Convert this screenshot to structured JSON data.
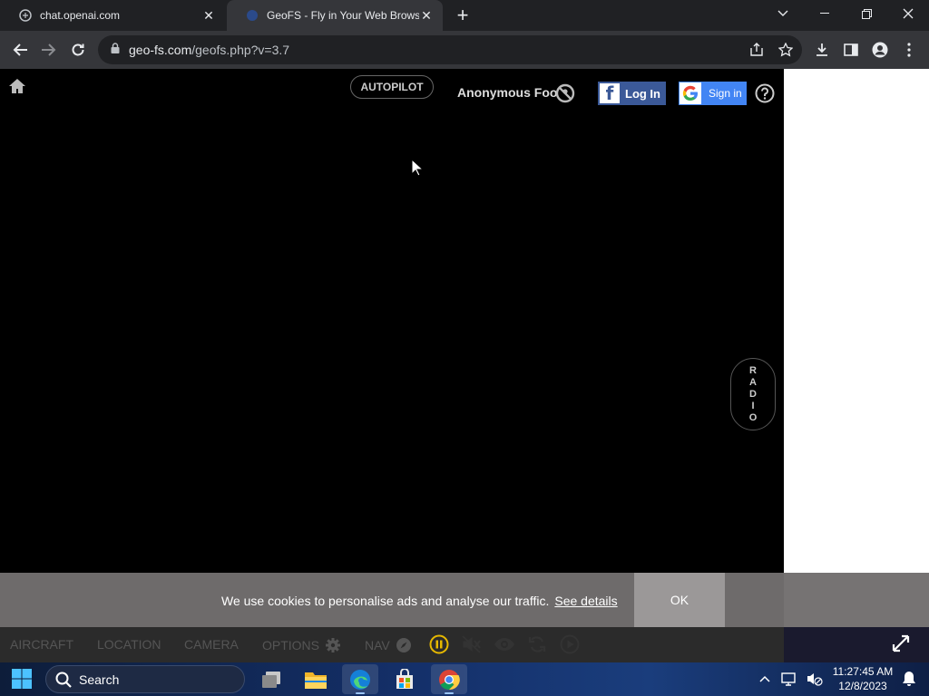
{
  "browser": {
    "tabs": [
      {
        "title": "chat.openai.com",
        "icon": "openai-icon"
      },
      {
        "title": "GeoFS - Fly in Your Web Browse",
        "icon": "geofs-icon"
      }
    ],
    "new_tab": "+",
    "url_host": "geo-fs.com",
    "url_path": "/geofs.php?v=3.7"
  },
  "geofs": {
    "autopilot_label": "AUTOPILOT",
    "user_name": "Anonymous Foo",
    "facebook_login_label": "Log In",
    "google_signin_label": "Sign in",
    "radio_letters": [
      "R",
      "A",
      "D",
      "I",
      "O"
    ],
    "cookie": {
      "message": "We use cookies to personalise ads and analyse our traffic.",
      "details_link": "See details",
      "ok_label": "OK"
    },
    "menu": {
      "aircraft": "AIRCRAFT",
      "location": "LOCATION",
      "camera": "CAMERA",
      "options": "OPTIONS",
      "nav": "NAV"
    },
    "accent_color": "#e6b800"
  },
  "taskbar": {
    "search_placeholder": "Search",
    "time": "11:27:45 AM",
    "date": "12/8/2023"
  }
}
